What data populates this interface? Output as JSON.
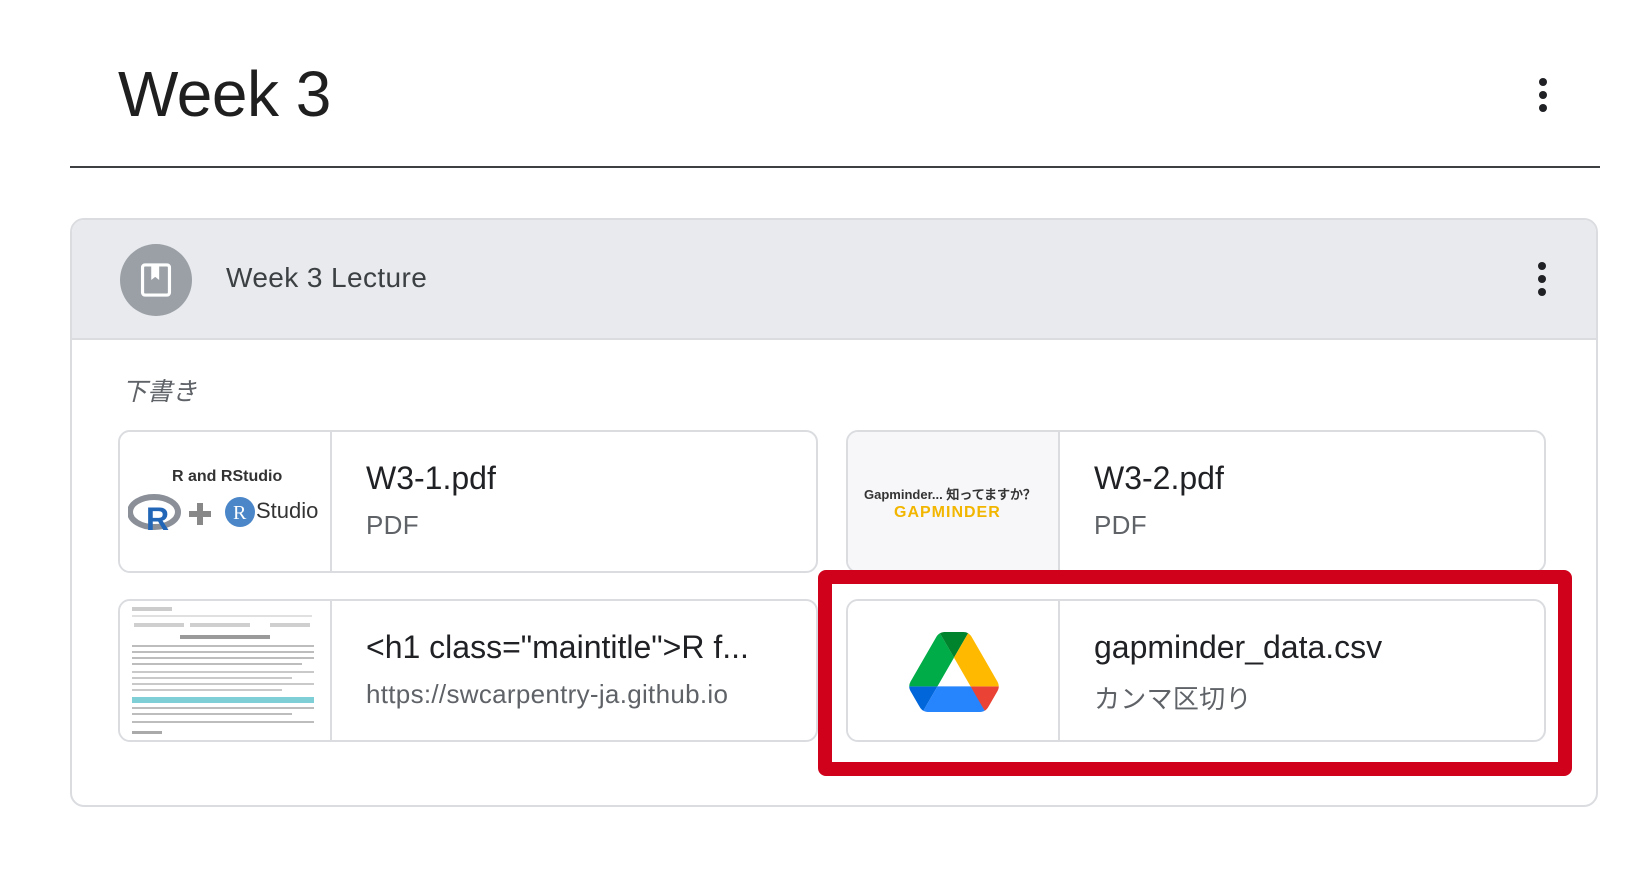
{
  "topic": {
    "title": "Week 3"
  },
  "material": {
    "title": "Week 3 Lecture",
    "status_label": "下書き"
  },
  "attachments": [
    {
      "title": "W3-1.pdf",
      "subtitle": "PDF",
      "thumb_text": "R and RStudio",
      "thumb_text_2": "Studio"
    },
    {
      "title": "W3-2.pdf",
      "subtitle": "PDF",
      "thumb_text": "Gapminder... 知ってますか？",
      "thumb_text_2": "GAPMINDER"
    },
    {
      "title": "<h1 class=\"maintitle\">R f...",
      "subtitle": "https://swcarpentry-ja.github.io"
    },
    {
      "title": "gapminder_data.csv",
      "subtitle": "カンマ区切り"
    }
  ],
  "colors": {
    "highlight": "#d0021b",
    "header_bg": "#e8eaed"
  },
  "icons": [
    "more-vert-icon",
    "book-icon",
    "google-drive-icon"
  ]
}
